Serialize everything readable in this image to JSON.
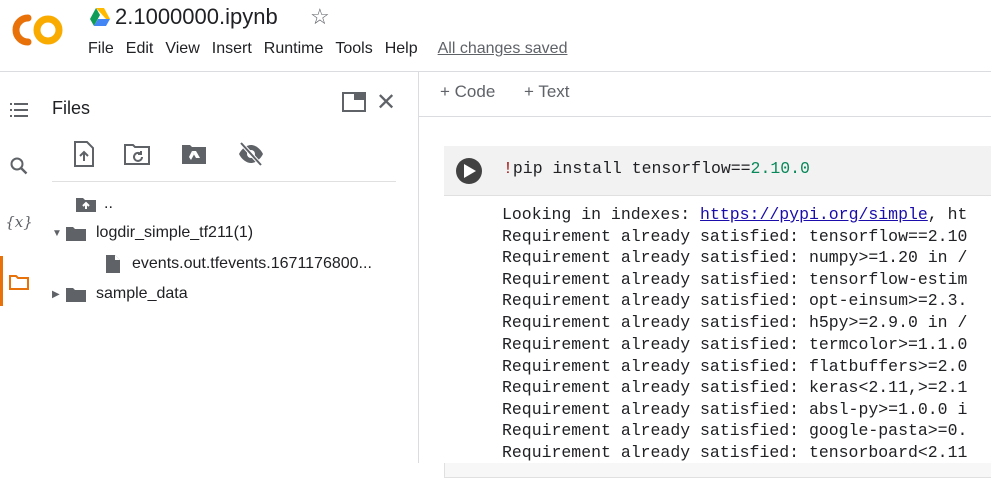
{
  "app": {
    "logo_text": "CO",
    "notebook_title": "2.1000000.ipynb"
  },
  "menu": {
    "items": [
      "File",
      "Edit",
      "View",
      "Insert",
      "Runtime",
      "Tools",
      "Help"
    ],
    "save_status": "All changes saved"
  },
  "files_panel": {
    "title": "Files",
    "tree": [
      {
        "label": "..",
        "kind": "parent"
      },
      {
        "label": "logdir_simple_tf211(1)",
        "kind": "folder",
        "expanded": true
      },
      {
        "label": "events.out.tfevents.1671176800...",
        "kind": "file"
      },
      {
        "label": "sample_data",
        "kind": "folder",
        "expanded": false
      }
    ]
  },
  "toolbar": {
    "add_code": "+ Code",
    "add_text": "+ Text"
  },
  "cell": {
    "code_bang": "!",
    "code_main": "pip install tensorflow==",
    "code_version": "2.10.0",
    "output_prefix": "Looking in indexes: ",
    "output_link": "https://pypi.org/simple",
    "output_link_suffix": ", ht",
    "output_lines": [
      "Requirement already satisfied: tensorflow==2.10",
      "Requirement already satisfied: numpy>=1.20 in /",
      "Requirement already satisfied: tensorflow-estim",
      "Requirement already satisfied: opt-einsum>=2.3.",
      "Requirement already satisfied: h5py>=2.9.0 in /",
      "Requirement already satisfied: termcolor>=1.1.0",
      "Requirement already satisfied: flatbuffers>=2.0",
      "Requirement already satisfied: keras<2.11,>=2.1",
      "Requirement already satisfied: absl-py>=1.0.0 i",
      "Requirement already satisfied: google-pasta>=0.",
      "Requirement already satisfied: tensorboard<2.11"
    ]
  },
  "colors": {
    "brand_orange": "#f9ab00",
    "brand_orange_dark": "#e8710a",
    "link": "#1a0dab",
    "number": "#09885a"
  }
}
